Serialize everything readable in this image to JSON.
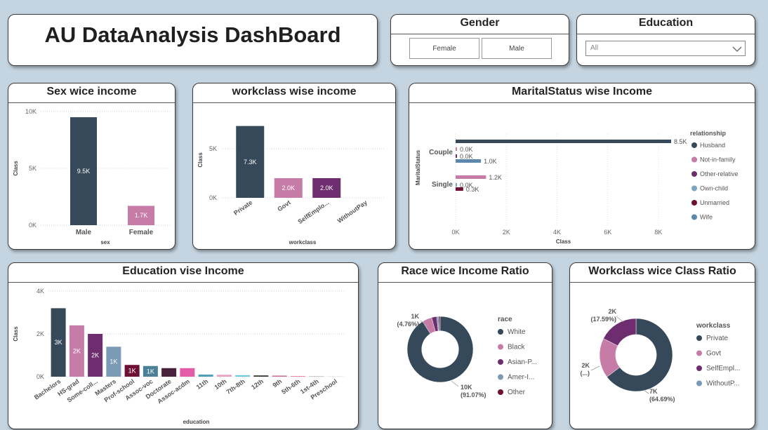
{
  "header": {
    "title": "AU DataAnalysis DashBoard"
  },
  "gender_slicer": {
    "title": "Gender",
    "options": [
      "Female",
      "Male"
    ]
  },
  "education_slicer": {
    "title": "Education",
    "selected": "All"
  },
  "colors": {
    "dark": "#35495a",
    "pink": "#c77ca7",
    "purple": "#6e2d6e",
    "steel": "#7b9ab6",
    "maroon": "#6e0f35",
    "teal": "#4c8098",
    "plum": "#48223d",
    "magenta": "#e35ca8",
    "husband": "#35495a",
    "not_in_family": "#c77ca7",
    "other_relative": "#6e2d6e",
    "own_child": "#7aa5bf",
    "unmarried": "#6e0f35",
    "wife": "#5e87ad"
  },
  "sex_chart": {
    "title": "Sex wice income",
    "chart_data": {
      "type": "bar",
      "categories": [
        "Male",
        "Female"
      ],
      "values": [
        9.5,
        1.7
      ],
      "data_labels": [
        "9.5K",
        "1.7K"
      ],
      "yticks": [
        "10K",
        "5K",
        "0K"
      ],
      "xlabel": "sex",
      "ylabel": "Class",
      "ylim": [
        0,
        10
      ]
    }
  },
  "workclass_chart": {
    "title": "workclass wise income",
    "chart_data": {
      "type": "bar",
      "categories": [
        "Private",
        "Govt",
        "SelfEmplo...",
        "WithoutPay"
      ],
      "values": [
        7.3,
        2.0,
        2.0,
        0
      ],
      "data_labels": [
        "7.3K",
        "2.0K",
        "2.0K",
        ""
      ],
      "yticks": [
        "5K",
        "0K"
      ],
      "xlabel": "workclass",
      "ylabel": "Class",
      "ylim": [
        0,
        7.7
      ]
    }
  },
  "marital_chart": {
    "title": "MaritalStatus wise Income",
    "chart_data": {
      "type": "bar",
      "orientation": "horizontal",
      "categories": [
        "Couple",
        "Single"
      ],
      "series": [
        {
          "name": "Husband",
          "values": [
            8.5,
            0
          ]
        },
        {
          "name": "Not-in-family",
          "values": [
            0.0,
            1.2
          ]
        },
        {
          "name": "Other-relative",
          "values": [
            0.0,
            0.0
          ]
        },
        {
          "name": "Own-child",
          "values": [
            0,
            0.0
          ]
        },
        {
          "name": "Unmarried",
          "values": [
            0,
            0.3
          ]
        },
        {
          "name": "Wife",
          "values": [
            1.0,
            0
          ]
        }
      ],
      "couple_labels": [
        "8.5K",
        "0.0K",
        "0.0K",
        "1.0K"
      ],
      "single_labels": [
        "1.2K",
        "0.0K",
        "0.3K"
      ],
      "xticks": [
        "0K",
        "2K",
        "4K",
        "6K",
        "8K"
      ],
      "xlabel": "Class",
      "ylabel": "MaritalStatus",
      "xlim": [
        0,
        8.5
      ],
      "legend_title": "relationship",
      "legend_position": "right"
    }
  },
  "education_chart": {
    "title": "Education vise Income",
    "chart_data": {
      "type": "bar",
      "categories": [
        "Bachelors",
        "HS-grad",
        "Some-coll...",
        "Masters",
        "Prof-school",
        "Assoc-voc",
        "Doctorate",
        "Assoc-acdm",
        "11th",
        "10th",
        "7th-8th",
        "12th",
        "9th",
        "5th-6th",
        "1st-4th",
        "Preschool"
      ],
      "values": [
        3.2,
        2.4,
        2.0,
        1.4,
        0.55,
        0.5,
        0.4,
        0.4,
        0.1,
        0.09,
        0.07,
        0.06,
        0.05,
        0.03,
        0.02,
        0.01
      ],
      "data_labels": [
        "3K",
        "2K",
        "2K",
        "1K",
        "1K",
        "1K",
        "",
        "",
        "",
        "",
        "",
        "",
        "",
        "",
        "",
        ""
      ],
      "yticks": [
        "4K",
        "2K",
        "0K"
      ],
      "xlabel": "education",
      "ylabel": "Class",
      "ylim": [
        0,
        4
      ]
    }
  },
  "race_chart": {
    "title": "Race wice Income Ratio",
    "chart_data": {
      "type": "pie",
      "style": "donut",
      "categories": [
        "White",
        "Black",
        "Asian-P...",
        "Amer-I...",
        "Other"
      ],
      "values": [
        91.07,
        4.76,
        2.5,
        1.0,
        0.67
      ],
      "labels": [
        {
          "value": "10K",
          "pct": "(91.07%)"
        },
        {
          "value": "1K",
          "pct": "(4.76%)"
        }
      ],
      "legend_title": "race",
      "legend_position": "right"
    }
  },
  "workclass_ratio_chart": {
    "title": "Workclass wice Class Ratio",
    "chart_data": {
      "type": "pie",
      "style": "donut",
      "categories": [
        "Private",
        "Govt",
        "SelfEmpl...",
        "WithoutP..."
      ],
      "values": [
        64.69,
        17.72,
        17.59,
        0
      ],
      "labels": [
        {
          "value": "7K",
          "pct": "(64.69%)"
        },
        {
          "value": "2K",
          "pct": "(...)"
        },
        {
          "value": "2K",
          "pct": "(17.59%)"
        }
      ],
      "legend_title": "workclass",
      "legend_position": "right"
    }
  }
}
